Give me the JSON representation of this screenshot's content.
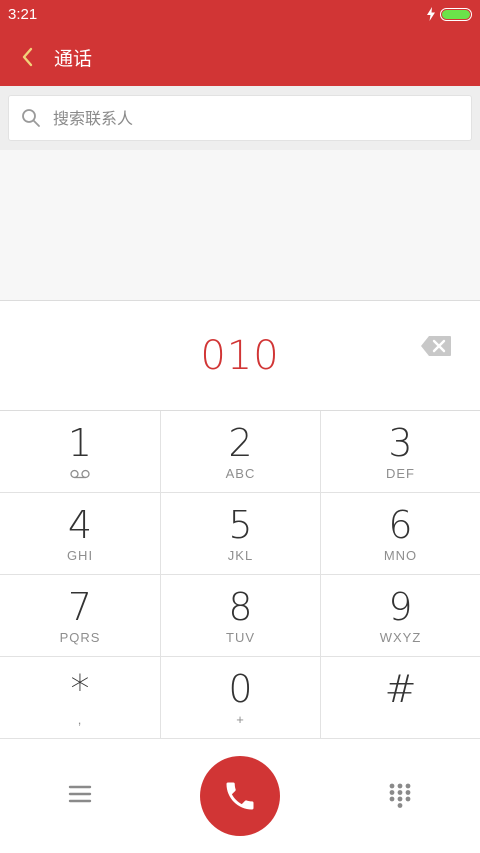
{
  "status_bar": {
    "time": "3:21"
  },
  "header": {
    "title": "通话"
  },
  "search": {
    "placeholder": "搜索联系人",
    "value": ""
  },
  "dialer": {
    "number": "010",
    "keys": [
      [
        {
          "digit": "1",
          "letters": "",
          "icon": "voicemail-icon"
        },
        {
          "digit": "2",
          "letters": "ABC"
        },
        {
          "digit": "3",
          "letters": "DEF"
        }
      ],
      [
        {
          "digit": "4",
          "letters": "GHI"
        },
        {
          "digit": "5",
          "letters": "JKL"
        },
        {
          "digit": "6",
          "letters": "MNO"
        }
      ],
      [
        {
          "digit": "7",
          "letters": "PQRS"
        },
        {
          "digit": "8",
          "letters": "TUV"
        },
        {
          "digit": "9",
          "letters": "WXYZ"
        }
      ],
      [
        {
          "digit": "*",
          "letters": ","
        },
        {
          "digit": "0",
          "letters": "+"
        },
        {
          "digit": "#",
          "letters": ""
        }
      ]
    ]
  },
  "colors": {
    "accent": "#d13535",
    "battery": "#6be24a"
  }
}
